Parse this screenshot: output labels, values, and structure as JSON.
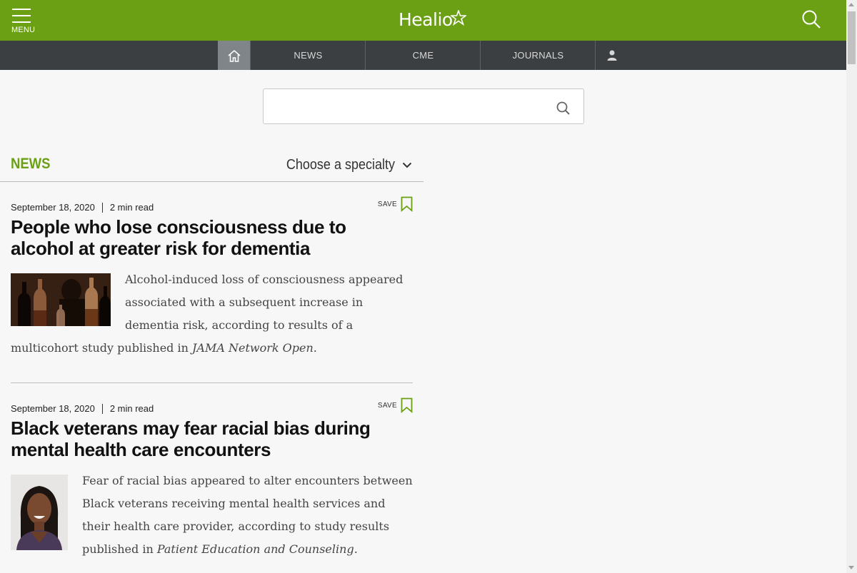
{
  "header": {
    "menu_label": "MENU",
    "logo_text": "Healio",
    "brand_color": "#6ba014",
    "nav_color": "#3b3f42"
  },
  "nav": {
    "home_icon": "home-icon",
    "items": [
      {
        "label": "NEWS"
      },
      {
        "label": "CME"
      },
      {
        "label": "JOURNALS"
      }
    ],
    "user_icon": "user-icon"
  },
  "search": {
    "value": "",
    "placeholder": ""
  },
  "news_section": {
    "title": "NEWS",
    "specialty_select": "Choose a specialty"
  },
  "articles": [
    {
      "date": "September 18, 2020",
      "read_time": "2 min read",
      "save_label": "SAVE",
      "headline": "People who lose consciousness due to alcohol at greater risk for dementia",
      "summary": "Alcohol-induced loss of consciousness appeared associated with a subsequent increase in dementia risk, according to results of a multicohort study published in ",
      "source": "JAMA Network Open",
      "summary_end": ".",
      "image_desc": "bottles-image"
    },
    {
      "date": "September 18, 2020",
      "read_time": "2 min read",
      "save_label": "SAVE",
      "headline": "Black veterans may fear racial bias during mental health care encounters",
      "summary": "Fear of racial bias appeared to alter encounters between Black veterans receiving mental health services and their health care provider, according to study results published in ",
      "source": "Patient Education and Counseling",
      "summary_end": ".",
      "image_desc": "portrait-image"
    }
  ]
}
